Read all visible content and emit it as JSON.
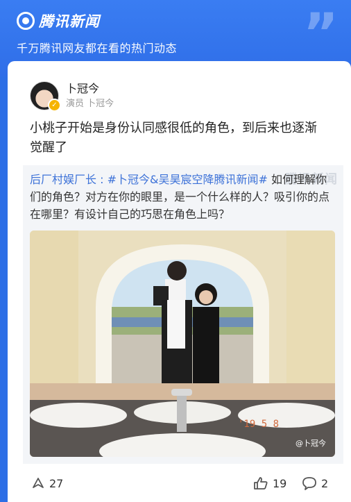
{
  "app": {
    "brand": "腾讯新闻",
    "tagline": "千万腾讯网友都在看的热门动态"
  },
  "post": {
    "author_name": "卜冠今",
    "author_title": "演员 卜冠今",
    "text": "小桃子开始是身份认同感很低的角色，到后来也逐渐觉醒了"
  },
  "quote": {
    "prefix": "后厂村娱厂长 : ",
    "tag": "#卜冠今&吴昊宸空降腾讯新闻#",
    "body": " 如何理解你们的角色？对方在你的眼里，是一个什么样的人？吸引你的点在哪里？有设计自己的巧思在角色上吗？",
    "watermark": "腾讯新闻",
    "photo_date": "'19 5 8",
    "photo_credit": "@卜冠今"
  },
  "actions": {
    "share_count": "27",
    "like_count": "19",
    "comment_count": "2"
  },
  "colors": {
    "brand_blue": "#2f6ee8",
    "link_blue": "#3d72d8"
  }
}
